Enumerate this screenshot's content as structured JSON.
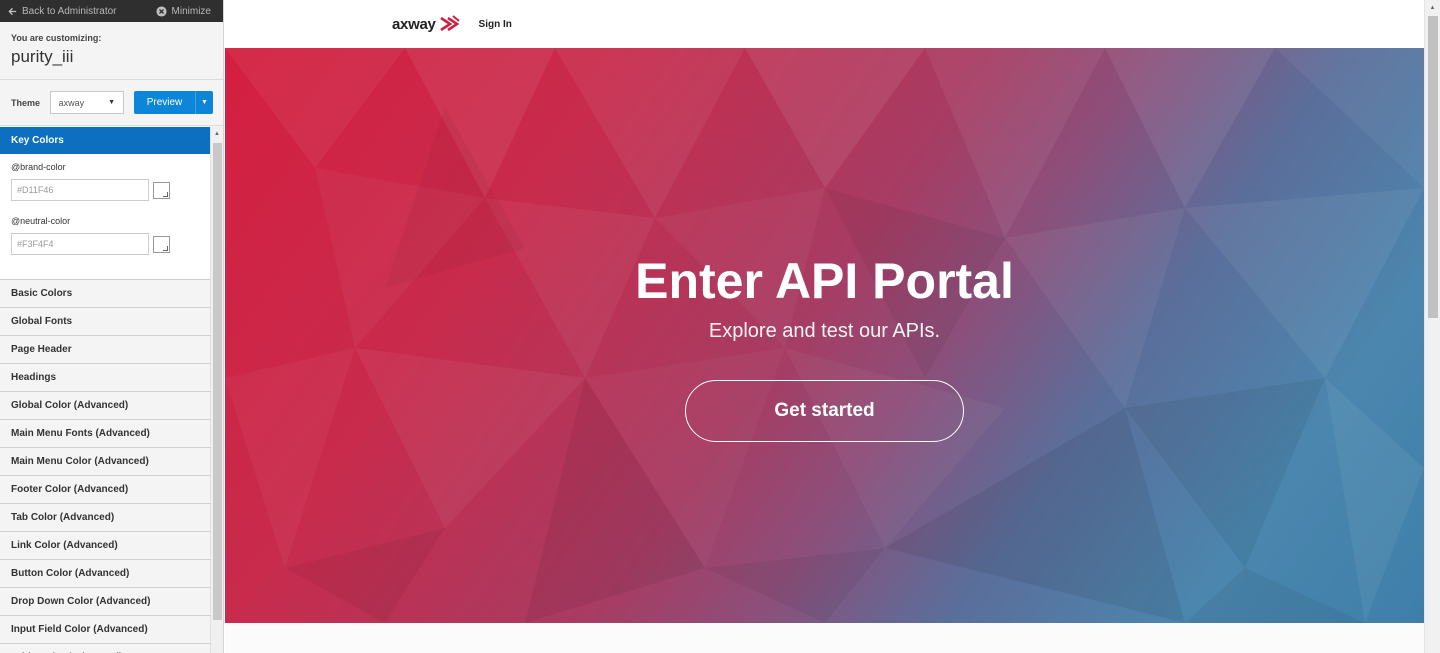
{
  "customizer": {
    "back_label": "Back to Administrator",
    "minimize_label": "Minimize",
    "customizing_label": "You are customizing:",
    "template_name": "purity_iii",
    "theme_label": "Theme",
    "theme_value": "axway",
    "preview_label": "Preview",
    "key_colors": {
      "header": "Key Colors",
      "vars": [
        {
          "label": "@brand-color",
          "value": "#D11F46"
        },
        {
          "label": "@neutral-color",
          "value": "#F3F4F4"
        }
      ]
    },
    "sections": [
      "Basic Colors",
      "Global Fonts",
      "Page Header",
      "Headings",
      "Global Color (Advanced)",
      "Main Menu Fonts (Advanced)",
      "Main Menu Color (Advanced)",
      "Footer Color (Advanced)",
      "Tab Color (Advanced)",
      "Link Color (Advanced)",
      "Button Color (Advanced)",
      "Drop Down Color (Advanced)",
      "Input Field Color (Advanced)",
      "Table Color (Advanced)"
    ]
  },
  "site": {
    "brand": "axway",
    "sign_in": "Sign In",
    "hero": {
      "title": "Enter API Portal",
      "subtitle": "Explore and test our APIs.",
      "cta": "Get started"
    }
  },
  "colors": {
    "accent_blue": "#0d85d8",
    "brand_red": "#D11F46"
  }
}
